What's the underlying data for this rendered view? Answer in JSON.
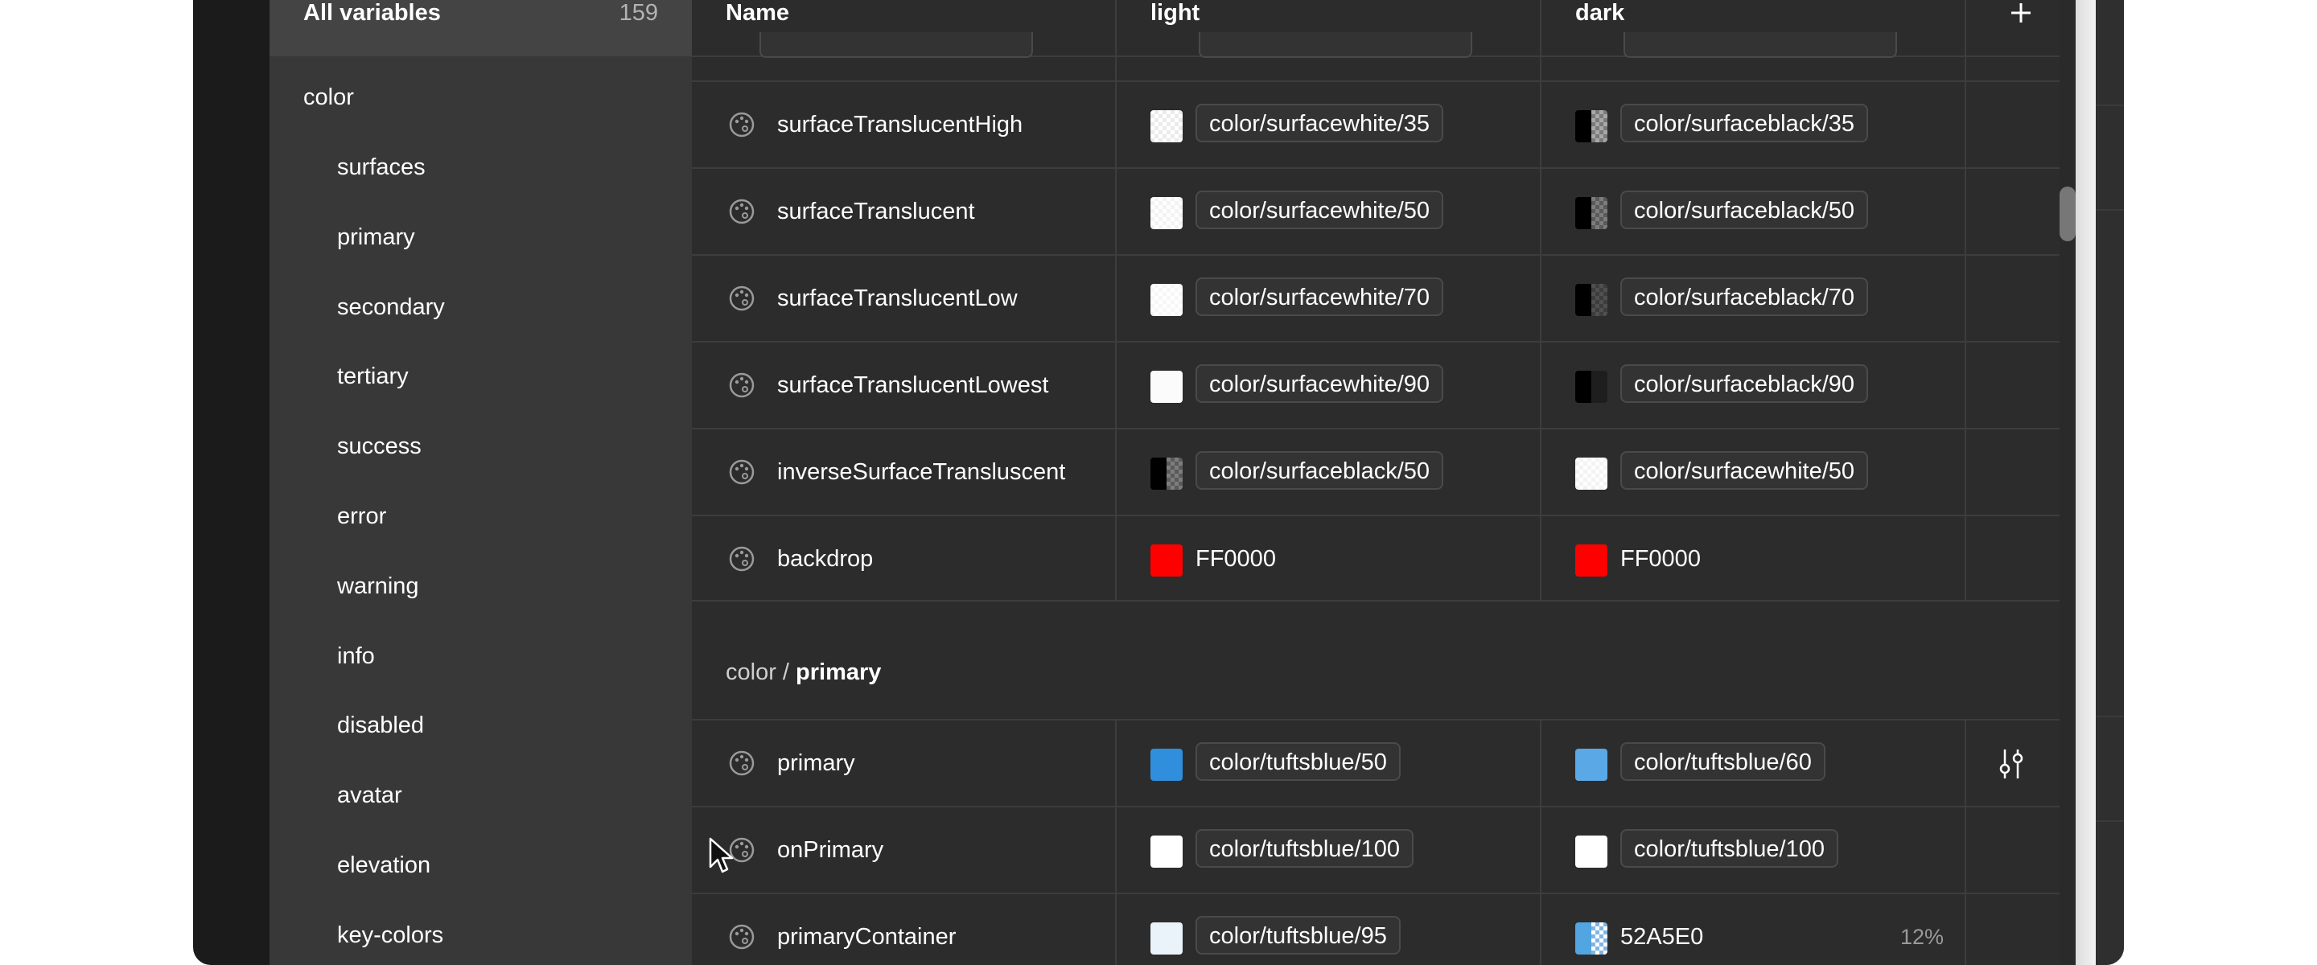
{
  "sidebar": {
    "all_label": "All variables",
    "all_count": "159",
    "group": "color",
    "items": [
      "surfaces",
      "primary",
      "secondary",
      "tertiary",
      "success",
      "error",
      "warning",
      "info",
      "disabled",
      "avatar",
      "elevation",
      "key-colors"
    ]
  },
  "table": {
    "headers": {
      "name": "Name",
      "light": "light",
      "dark": "dark"
    },
    "add_icon": "plus-icon",
    "rows_top": [
      {
        "name": "surfaceTranslucentHigh",
        "light": "color/surfacewhite/35",
        "dark": "color/surfaceblack/35"
      },
      {
        "name": "surfaceTranslucent",
        "light": "color/surfacewhite/50",
        "dark": "color/surfaceblack/50"
      },
      {
        "name": "surfaceTranslucentLow",
        "light": "color/surfacewhite/70",
        "dark": "color/surfaceblack/70"
      },
      {
        "name": "surfaceTranslucentLowest",
        "light": "color/surfacewhite/90",
        "dark": "color/surfaceblack/90"
      },
      {
        "name": "inverseSurfaceTransluscent",
        "light": "color/surfaceblack/50",
        "dark": "color/surfacewhite/50"
      },
      {
        "name": "backdrop",
        "light": "FF0000",
        "dark": "FF0000"
      }
    ],
    "group_title": {
      "prefix": "color",
      "separator": "/",
      "name": "primary"
    },
    "rows_bottom": [
      {
        "name": "primary",
        "light": "color/tuftsblue/50",
        "dark": "color/tuftsblue/60"
      },
      {
        "name": "onPrimary",
        "light": "color/tuftsblue/100",
        "dark": "color/tuftsblue/100"
      },
      {
        "name": "primaryContainer",
        "light": "color/tuftsblue/95",
        "dark": "52A5E0",
        "dark_opacity": "12%"
      }
    ]
  },
  "colors": {
    "backdrop": "#FF0000",
    "primary_container_dark": "#52A5E0"
  }
}
